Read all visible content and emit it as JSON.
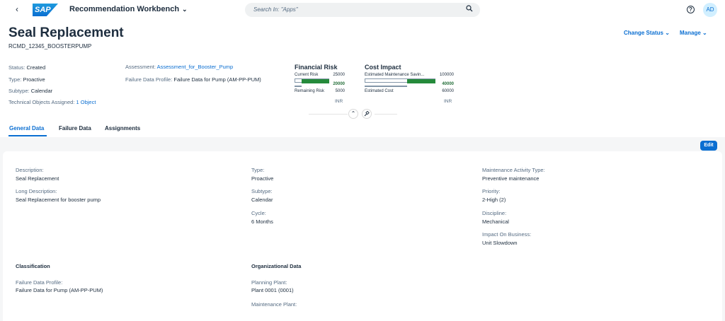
{
  "shell": {
    "back_label": "‹",
    "logo": "SAP",
    "app_title": "Recommendation Workbench",
    "search_placeholder": "Search In: \"Apps\"",
    "help_icon": "?",
    "avatar_initials": "AD"
  },
  "header": {
    "title": "Seal Replacement",
    "subtitle": "RCMD_12345_BOOSTERPUMP",
    "actions": [
      "Change Status",
      "Manage"
    ],
    "status": {
      "label": "Status:",
      "value": "Created"
    },
    "type": {
      "label": "Type:",
      "value": "Proactive"
    },
    "subtype": {
      "label": "Subtype:",
      "value": "Calendar"
    },
    "technical_objects": {
      "label": "Technical Objects Assigned:",
      "value": "1 Object"
    },
    "assessment": {
      "label": "Assessment:",
      "value": "Assessment_for_Booster_Pump"
    },
    "failure_profile": {
      "label": "Failure Data Profile:",
      "value": "Failure Data for Pump (AM-PP-PUM)"
    }
  },
  "kpis": {
    "financial_risk": {
      "title": "Financial Risk",
      "current_label": "Current Risk",
      "current_value": "25000",
      "bar_value": "20000",
      "remaining_label": "Remaining Risk",
      "remaining_value": "5000",
      "unit": "INR",
      "current_fraction": 1.0,
      "green_fraction": 0.8,
      "remaining_fraction": 0.2
    },
    "cost_impact": {
      "title": "Cost Impact",
      "estimated_label": "Estimated Maintenance Savin...",
      "estimated_value": "100000",
      "bar_value": "40000",
      "cost_label": "Estimated Cost",
      "cost_value": "60000",
      "unit": "INR",
      "savings_fraction": 1.0,
      "green_fraction": 0.4,
      "cost_fraction": 0.6
    }
  },
  "tabs": [
    "General Data",
    "Failure Data",
    "Assignments"
  ],
  "edit_label": "Edit",
  "general": {
    "description": {
      "label": "Description:",
      "value": "Seal Replacement"
    },
    "long_description": {
      "label": "Long Description:",
      "value": "Seal Replacement for booster pump"
    },
    "type": {
      "label": "Type:",
      "value": "Proactive"
    },
    "subtype": {
      "label": "Subtype:",
      "value": "Calendar"
    },
    "cycle": {
      "label": "Cycle:",
      "value": "6 Months"
    },
    "activity_type": {
      "label": "Maintenance Activity Type:",
      "value": "Preventive maintenance"
    },
    "priority": {
      "label": "Priority:",
      "value": "2-High (2)"
    },
    "discipline": {
      "label": "Discipline:",
      "value": "Mechanical"
    },
    "impact": {
      "label": "Impact On Business:",
      "value": "Unit Slowdown"
    }
  },
  "classification": {
    "title": "Classification",
    "failure_profile": {
      "label": "Failure Data Profile:",
      "value": "Failure Data for Pump (AM-PP-PUM)"
    }
  },
  "organizational": {
    "title": "Organizational Data",
    "planning_plant": {
      "label": "Planning Plant:",
      "value": "Plant 0001 (0001)"
    },
    "maintenance_plant": {
      "label": "Maintenance Plant:",
      "value": ""
    }
  }
}
